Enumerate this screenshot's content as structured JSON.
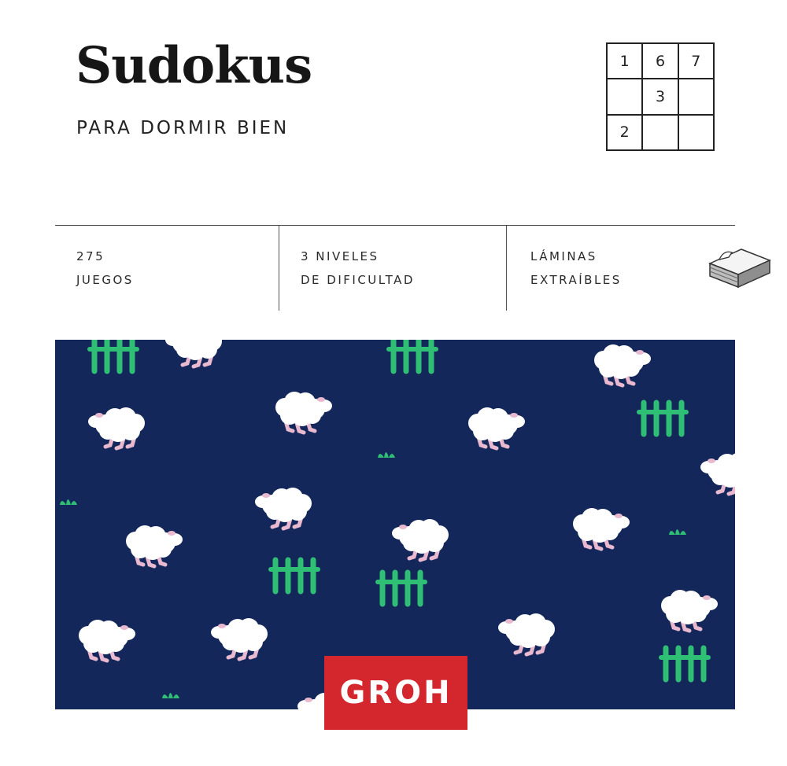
{
  "cover": {
    "title": "Sudokus",
    "subtitle": "PARA DORMIR BIEN"
  },
  "sudoku_grid": [
    "1",
    "6",
    "7",
    "",
    "3",
    "",
    "2",
    "",
    ""
  ],
  "features": [
    {
      "line1": "275",
      "line2": "JUEGOS"
    },
    {
      "line1": "3 NIVELES",
      "line2": "DE DIFICULTAD"
    },
    {
      "line1": "LÁMINAS",
      "line2": "EXTRAÍBLES",
      "icon": "tear-off-sheets-icon"
    }
  ],
  "brand": {
    "logo_text": "GROH"
  },
  "colors": {
    "pattern_background": "#14275a",
    "sheep_wool": "#ffffff",
    "sheep_legs": "#e8b9cf",
    "grass_fence": "#2fbf74",
    "brand_red": "#d3262d"
  }
}
